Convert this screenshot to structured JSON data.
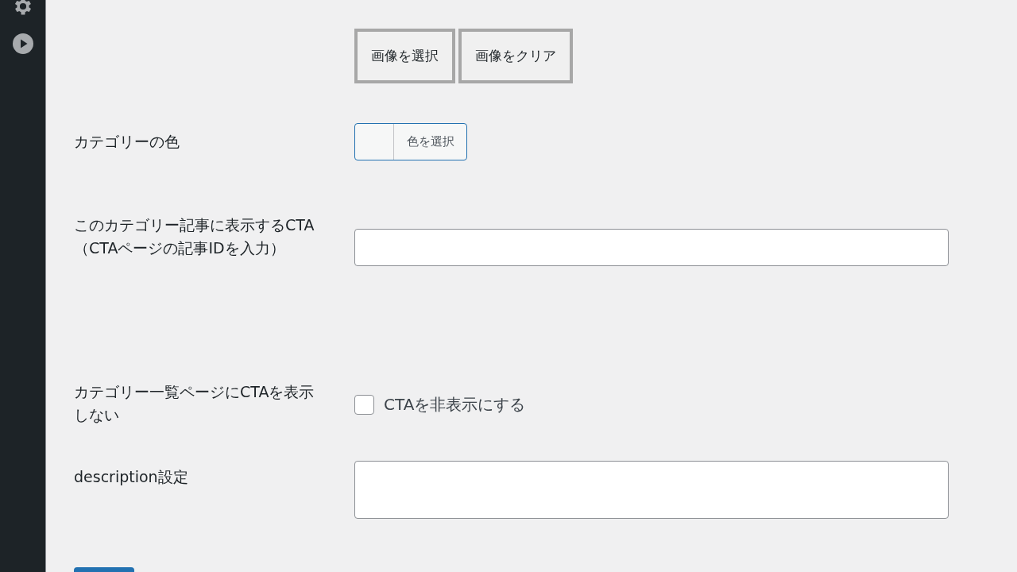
{
  "image_buttons": [
    "画像を選択",
    "画像をクリア"
  ],
  "color_field": {
    "label": "カテゴリーの色",
    "button": "色を選択"
  },
  "cta_field": {
    "label": "このカテゴリー記事に表示するCTA（CTAページの記事IDを入力）"
  },
  "hide_cta": {
    "label": "カテゴリー一覧ページにCTAを表示しない",
    "checkbox_label": "CTAを非表示にする",
    "checked": false
  },
  "description": {
    "label": "description設定"
  }
}
